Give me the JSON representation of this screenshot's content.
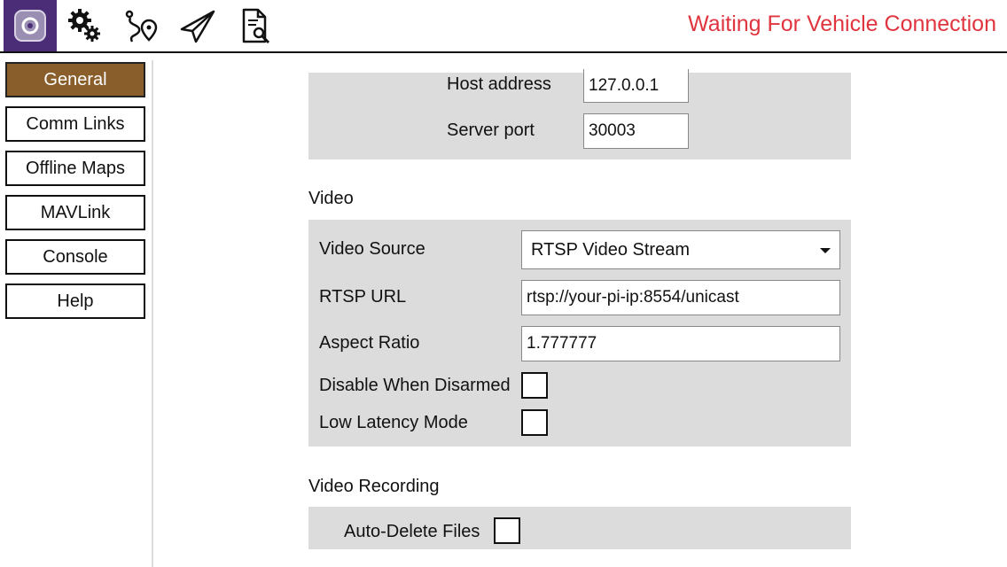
{
  "toolbar": {
    "icons": [
      "app-logo-icon",
      "settings-gears-icon",
      "plan-route-icon",
      "fly-paper-plane-icon",
      "analyze-document-icon"
    ],
    "status": "Waiting For Vehicle Connection",
    "status_color": "#e0353f",
    "brand_color": "#4b2c77"
  },
  "sidebar": {
    "items": [
      {
        "label": "General",
        "active": true
      },
      {
        "label": "Comm Links"
      },
      {
        "label": "Offline Maps"
      },
      {
        "label": "MAVLink"
      },
      {
        "label": "Console"
      },
      {
        "label": "Help"
      }
    ],
    "active_color": "#8a5e2a"
  },
  "server": {
    "host_label": "Host address",
    "host_value": "127.0.0.1",
    "port_label": "Server port",
    "port_value": "30003"
  },
  "video": {
    "title": "Video",
    "source_label": "Video Source",
    "source_value": "RTSP Video Stream",
    "rtsp_label": "RTSP URL",
    "rtsp_value": "rtsp://your-pi-ip:8554/unicast",
    "aspect_label": "Aspect Ratio",
    "aspect_value": "1.777777",
    "disable_label": "Disable When Disarmed",
    "disable_checked": false,
    "lowlat_label": "Low Latency Mode",
    "lowlat_checked": false
  },
  "recording": {
    "title": "Video Recording",
    "autodelete_label": "Auto-Delete Files",
    "autodelete_checked": false
  }
}
